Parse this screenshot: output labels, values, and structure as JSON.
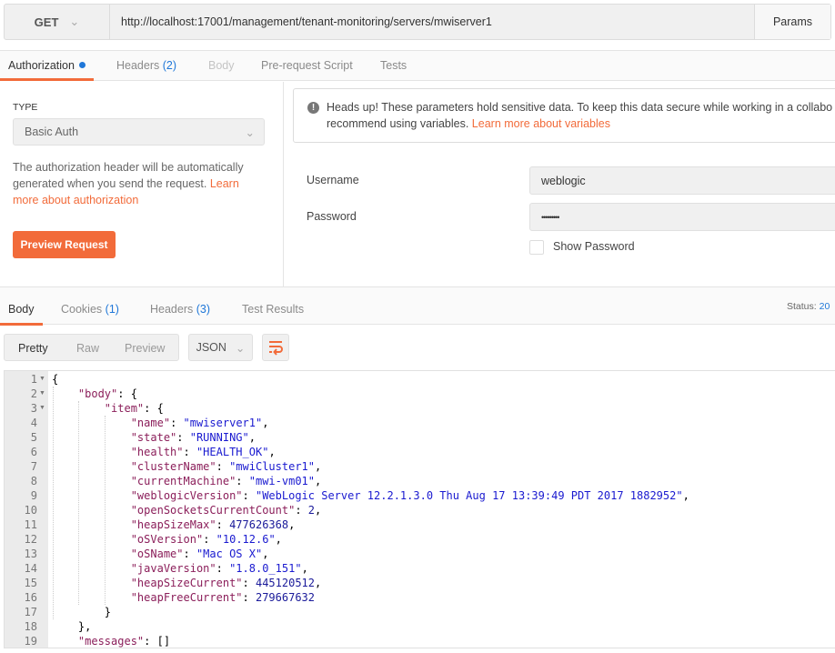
{
  "request": {
    "method": "GET",
    "url": "http://localhost:17001/management/tenant-monitoring/servers/mwiserver1",
    "params_label": "Params"
  },
  "req_tabs": [
    {
      "label": "Authorization",
      "count": "",
      "active": true,
      "dot": true
    },
    {
      "label": "Headers",
      "count": "(2)"
    },
    {
      "label": "Body",
      "count": "",
      "disabled": true
    },
    {
      "label": "Pre-request Script",
      "count": ""
    },
    {
      "label": "Tests",
      "count": ""
    }
  ],
  "auth": {
    "type_label": "TYPE",
    "type_value": "Basic Auth",
    "desc": "The authorization header will be automatically generated when you send the request. ",
    "desc_link": "Learn more about authorization",
    "preview_button": "Preview Request",
    "notice": "Heads up! These parameters hold sensitive data. To keep this data secure while working in a collabo",
    "notice2": "recommend using variables. ",
    "notice_link": "Learn more about variables",
    "username_label": "Username",
    "username_value": "weblogic",
    "password_label": "Password",
    "password_value": "•••••••••",
    "show_password_label": "Show Password"
  },
  "resp_tabs": [
    {
      "label": "Body",
      "count": "",
      "active": true
    },
    {
      "label": "Cookies",
      "count": "(1)"
    },
    {
      "label": "Headers",
      "count": "(3)"
    },
    {
      "label": "Test Results",
      "count": ""
    }
  ],
  "status": {
    "label": "Status:",
    "value": "20"
  },
  "view_modes": [
    "Pretty",
    "Raw",
    "Preview"
  ],
  "format": "JSON",
  "colors": {
    "accent": "#f26b3a",
    "link_blue": "#1f77d8",
    "json_key": "#8b1e5a",
    "json_string": "#1a1ad0",
    "json_number": "#1a1a9a"
  },
  "code_lines": [
    [
      [
        "p",
        "{"
      ]
    ],
    [
      [
        "p",
        "    "
      ],
      [
        "k",
        "\"body\""
      ],
      [
        "p",
        ": {"
      ]
    ],
    [
      [
        "p",
        "        "
      ],
      [
        "k",
        "\"item\""
      ],
      [
        "p",
        ": {"
      ]
    ],
    [
      [
        "p",
        "            "
      ],
      [
        "k",
        "\"name\""
      ],
      [
        "p",
        ": "
      ],
      [
        "s",
        "\"mwiserver1\""
      ],
      [
        "p",
        ","
      ]
    ],
    [
      [
        "p",
        "            "
      ],
      [
        "k",
        "\"state\""
      ],
      [
        "p",
        ": "
      ],
      [
        "s",
        "\"RUNNING\""
      ],
      [
        "p",
        ","
      ]
    ],
    [
      [
        "p",
        "            "
      ],
      [
        "k",
        "\"health\""
      ],
      [
        "p",
        ": "
      ],
      [
        "s",
        "\"HEALTH_OK\""
      ],
      [
        "p",
        ","
      ]
    ],
    [
      [
        "p",
        "            "
      ],
      [
        "k",
        "\"clusterName\""
      ],
      [
        "p",
        ": "
      ],
      [
        "s",
        "\"mwiCluster1\""
      ],
      [
        "p",
        ","
      ]
    ],
    [
      [
        "p",
        "            "
      ],
      [
        "k",
        "\"currentMachine\""
      ],
      [
        "p",
        ": "
      ],
      [
        "s",
        "\"mwi-vm01\""
      ],
      [
        "p",
        ","
      ]
    ],
    [
      [
        "p",
        "            "
      ],
      [
        "k",
        "\"weblogicVersion\""
      ],
      [
        "p",
        ": "
      ],
      [
        "s",
        "\"WebLogic Server 12.2.1.3.0 Thu Aug 17 13:39:49 PDT 2017 1882952\""
      ],
      [
        "p",
        ","
      ]
    ],
    [
      [
        "p",
        "            "
      ],
      [
        "k",
        "\"openSocketsCurrentCount\""
      ],
      [
        "p",
        ": "
      ],
      [
        "n",
        "2"
      ],
      [
        "p",
        ","
      ]
    ],
    [
      [
        "p",
        "            "
      ],
      [
        "k",
        "\"heapSizeMax\""
      ],
      [
        "p",
        ": "
      ],
      [
        "n",
        "477626368"
      ],
      [
        "p",
        ","
      ]
    ],
    [
      [
        "p",
        "            "
      ],
      [
        "k",
        "\"oSVersion\""
      ],
      [
        "p",
        ": "
      ],
      [
        "s",
        "\"10.12.6\""
      ],
      [
        "p",
        ","
      ]
    ],
    [
      [
        "p",
        "            "
      ],
      [
        "k",
        "\"oSName\""
      ],
      [
        "p",
        ": "
      ],
      [
        "s",
        "\"Mac OS X\""
      ],
      [
        "p",
        ","
      ]
    ],
    [
      [
        "p",
        "            "
      ],
      [
        "k",
        "\"javaVersion\""
      ],
      [
        "p",
        ": "
      ],
      [
        "s",
        "\"1.8.0_151\""
      ],
      [
        "p",
        ","
      ]
    ],
    [
      [
        "p",
        "            "
      ],
      [
        "k",
        "\"heapSizeCurrent\""
      ],
      [
        "p",
        ": "
      ],
      [
        "n",
        "445120512"
      ],
      [
        "p",
        ","
      ]
    ],
    [
      [
        "p",
        "            "
      ],
      [
        "k",
        "\"heapFreeCurrent\""
      ],
      [
        "p",
        ": "
      ],
      [
        "n",
        "279667632"
      ]
    ],
    [
      [
        "p",
        "        }"
      ]
    ],
    [
      [
        "p",
        "    },"
      ]
    ],
    [
      [
        "p",
        "    "
      ],
      [
        "k",
        "\"messages\""
      ],
      [
        "p",
        ": []"
      ]
    ]
  ],
  "folds": [
    1,
    2,
    3
  ]
}
